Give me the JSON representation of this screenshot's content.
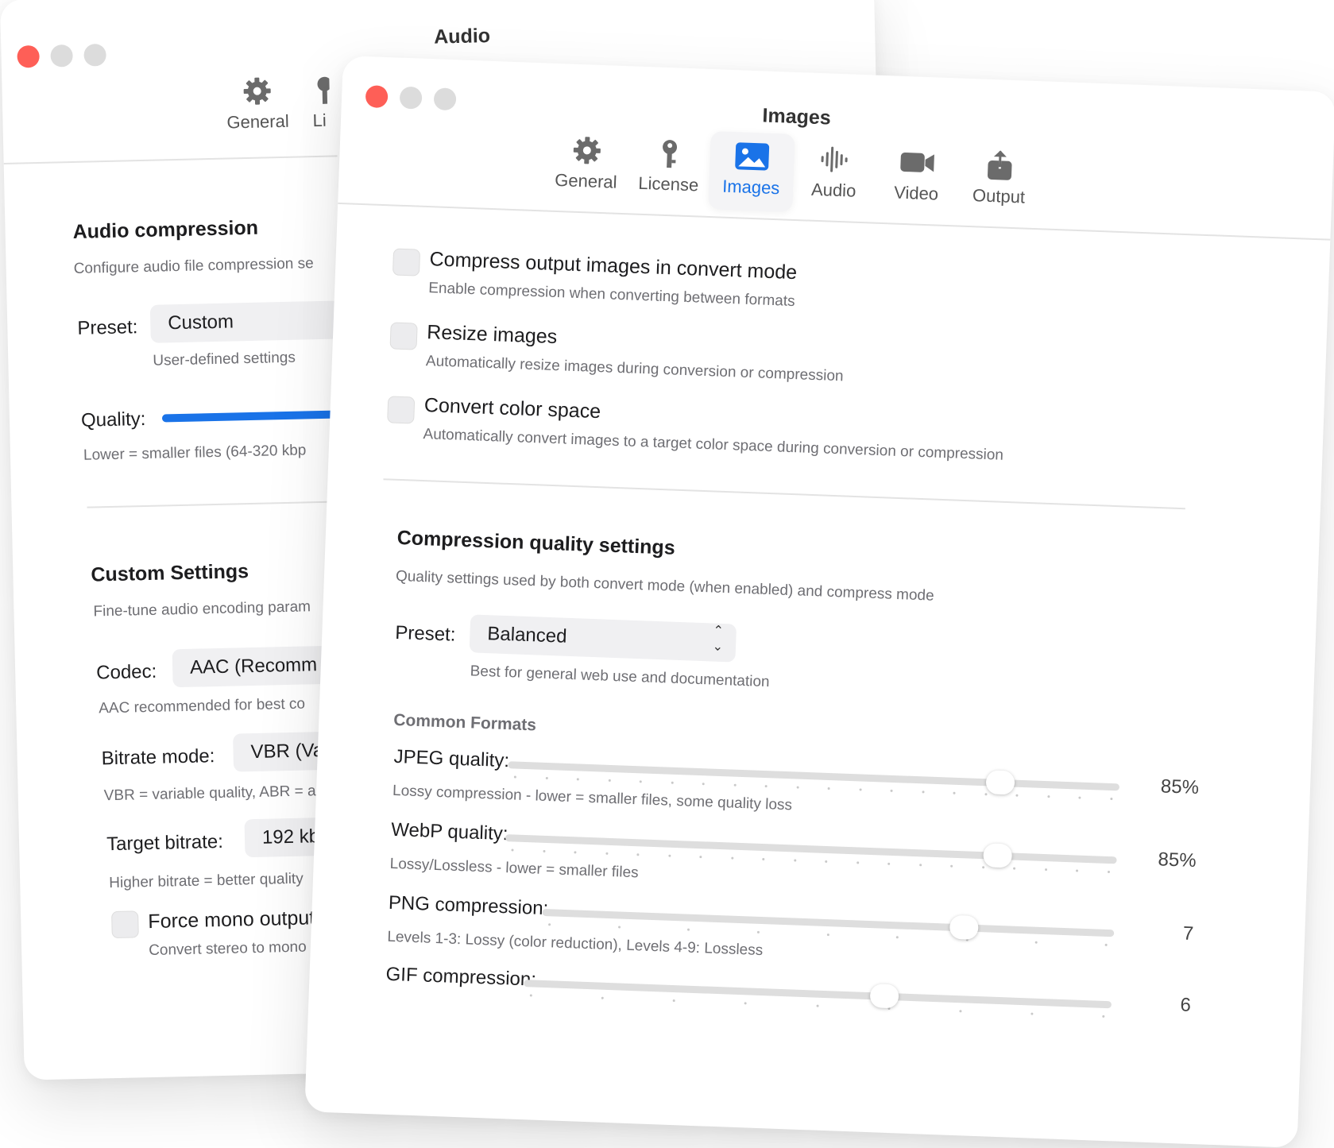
{
  "back_window": {
    "title": "Audio",
    "tabs": [
      {
        "label": "General",
        "icon": "gear-icon"
      },
      {
        "label": "Li",
        "icon": "key-icon"
      }
    ],
    "audio_compression": {
      "title": "Audio compression",
      "subtitle": "Configure audio file compression se",
      "preset_label": "Preset:",
      "preset_value": "Custom",
      "preset_hint": "User-defined settings",
      "quality_label": "Quality:",
      "quality_hint": "Lower = smaller files (64-320 kbp"
    },
    "custom_settings": {
      "title": "Custom Settings",
      "subtitle": "Fine-tune audio encoding param",
      "codec_label": "Codec:",
      "codec_value": "AAC (Recomm",
      "codec_hint": "AAC recommended for best co",
      "bitrate_mode_label": "Bitrate mode:",
      "bitrate_mode_value": "VBR (Va",
      "bitrate_mode_hint": "VBR = variable quality, ABR = a",
      "target_bitrate_label": "Target bitrate:",
      "target_bitrate_value": "192 kb",
      "target_bitrate_hint": "Higher bitrate = better quality",
      "force_mono_label": "Force mono output",
      "force_mono_hint": "Convert stereo to mono"
    }
  },
  "front_window": {
    "title": "Images",
    "tabs": [
      {
        "label": "General",
        "icon": "gear-icon"
      },
      {
        "label": "License",
        "icon": "key-icon"
      },
      {
        "label": "Images",
        "icon": "photo-icon",
        "selected": true
      },
      {
        "label": "Audio",
        "icon": "waveform-icon"
      },
      {
        "label": "Video",
        "icon": "video-camera-icon"
      },
      {
        "label": "Output",
        "icon": "share-icon"
      }
    ],
    "options": [
      {
        "title": "Compress output images in convert mode",
        "description": "Enable compression when converting between formats",
        "checked": false
      },
      {
        "title": "Resize images",
        "description": "Automatically resize images during conversion or compression",
        "checked": false
      },
      {
        "title": "Convert color space",
        "description": "Automatically convert images to a target color space during conversion or compression",
        "checked": false
      }
    ],
    "compression": {
      "title": "Compression quality settings",
      "subtitle": "Quality settings used by both convert mode (when enabled) and compress mode",
      "preset_label": "Preset:",
      "preset_value": "Balanced",
      "preset_hint": "Best for general web use and documentation",
      "section_label": "Common Formats",
      "sliders": [
        {
          "label": "JPEG quality:",
          "hint": "Lossy compression - lower = smaller files, some quality loss",
          "value_text": "85%",
          "fraction": 0.82
        },
        {
          "label": "WebP quality:",
          "hint": "Lossy/Lossless - lower = smaller files",
          "value_text": "85%",
          "fraction": 0.82
        },
        {
          "label": "PNG compression:",
          "hint": "Levels 1-3: Lossy (color reduction), Levels 4-9: Lossless",
          "value_text": "7",
          "fraction": 0.75
        },
        {
          "label": "GIF compression:",
          "hint": "",
          "value_text": "6",
          "fraction": 0.62
        }
      ]
    }
  },
  "colors": {
    "accent": "#1a73e8",
    "close": "#fe5f57",
    "traffic_inactive": "#dcdcdc"
  }
}
